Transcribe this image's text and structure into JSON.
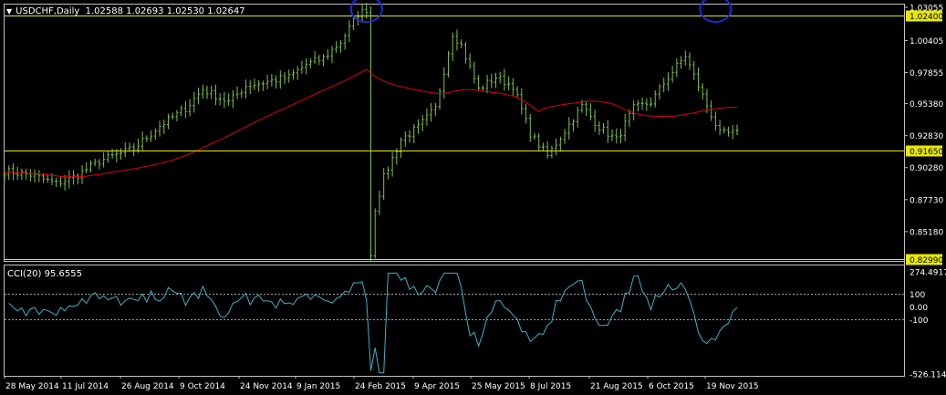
{
  "window": {
    "symbol_header": "USDCHF,Daily",
    "ohlc": "1.02588 1.02693 1.02530 1.02647",
    "indicator_header": "CCI(20) 95.6555"
  },
  "colors": {
    "background": "#000000",
    "candles": "#7FC241",
    "moving_average": "#E00000",
    "hline": "#E8E800",
    "cci_line": "#38B3C9",
    "circle": "#1A2BE0",
    "axis": "#C0C0C0",
    "text": "#FFFFFF"
  },
  "price_axis": {
    "labels": [
      "1.03055",
      "1.00405",
      "0.97855",
      "0.95380",
      "0.92830",
      "0.90280",
      "0.87730",
      "0.85180"
    ],
    "ylim": [
      0.8299,
      1.032
    ]
  },
  "hlines": [
    {
      "value": 1.024,
      "label": "1.02400"
    },
    {
      "value": 0.9165,
      "label": "0.91650"
    },
    {
      "value": 0.8299,
      "label": "0.82990"
    }
  ],
  "cci_axis": {
    "labels": [
      "274.4917",
      "100",
      "0.00",
      "-100",
      "-526.1143"
    ],
    "levels": [
      100,
      -100
    ],
    "ylim": [
      -526.1143,
      274.4917
    ]
  },
  "time_axis": {
    "labels": [
      "28 May 2014",
      "11 Jul 2014",
      "26 Aug 2014",
      "9 Oct 2014",
      "24 Nov 2014",
      "9 Jan 2015",
      "24 Feb 2015",
      "9 Apr 2015",
      "25 May 2015",
      "8 Jul 2015",
      "21 Aug 2015",
      "6 Oct 2015",
      "19 Nov 2015"
    ]
  },
  "chart_data": {
    "type": "line",
    "xlabel": "",
    "ylabel": "",
    "x_index_range": [
      0,
      170
    ],
    "series": [
      {
        "kind": "price_close",
        "values": [
          [
            0,
            0.9
          ],
          [
            6,
            0.897
          ],
          [
            12,
            0.89
          ],
          [
            16,
            0.895
          ],
          [
            22,
            0.908
          ],
          [
            30,
            0.918
          ],
          [
            36,
            0.936
          ],
          [
            42,
            0.95
          ],
          [
            46,
            0.965
          ],
          [
            52,
            0.955
          ],
          [
            56,
            0.968
          ],
          [
            62,
            0.972
          ],
          [
            66,
            0.975
          ],
          [
            70,
            0.985
          ],
          [
            74,
            0.99
          ],
          [
            78,
            1.003
          ],
          [
            82,
            1.025
          ],
          [
            84,
            1.029
          ],
          [
            85,
            0.833
          ],
          [
            86,
            0.87
          ],
          [
            88,
            0.895
          ],
          [
            92,
            0.925
          ],
          [
            96,
            0.935
          ],
          [
            100,
            0.95
          ],
          [
            104,
            1.01
          ],
          [
            106,
            1.0
          ],
          [
            110,
            0.965
          ],
          [
            114,
            0.975
          ],
          [
            118,
            0.968
          ],
          [
            122,
            0.93
          ],
          [
            126,
            0.912
          ],
          [
            130,
            0.932
          ],
          [
            134,
            0.952
          ],
          [
            138,
            0.935
          ],
          [
            142,
            0.925
          ],
          [
            146,
            0.95
          ],
          [
            150,
            0.955
          ],
          [
            154,
            0.975
          ],
          [
            158,
            0.992
          ],
          [
            162,
            0.96
          ],
          [
            166,
            0.93
          ]
        ]
      }
    ],
    "annotations": [
      "circle near 1.0290 around 9 Jan 2015",
      "circle near 1.0290 around 19 Nov 2015"
    ]
  }
}
